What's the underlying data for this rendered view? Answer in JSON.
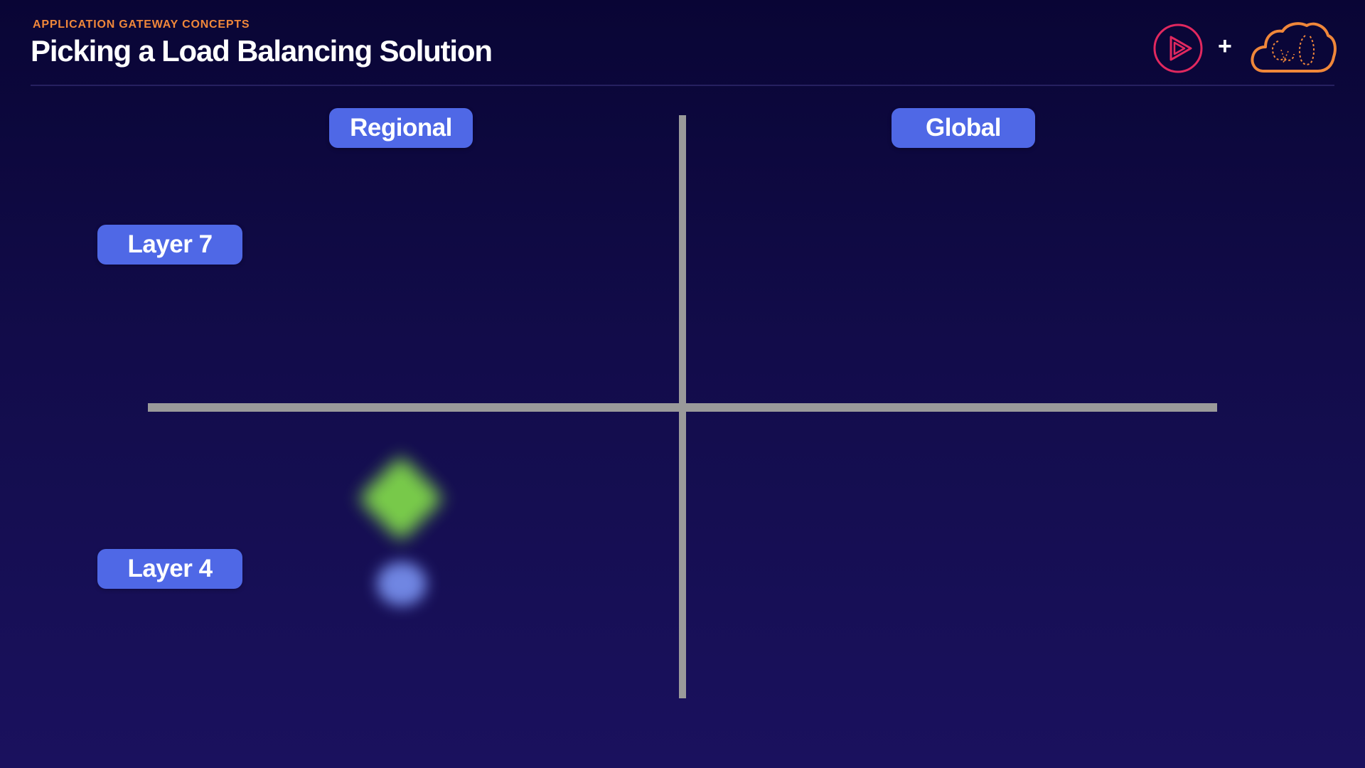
{
  "header": {
    "eyebrow": "APPLICATION GATEWAY CONCEPTS",
    "title": "Picking a Load Balancing Solution",
    "plus": "+"
  },
  "quadrant": {
    "columns": [
      "Regional",
      "Global"
    ],
    "rows": [
      "Layer 7",
      "Layer 4"
    ]
  },
  "markers": [
    {
      "shape": "diamond",
      "color": "#7ed44a",
      "quadrant": "Regional / Layer 4"
    },
    {
      "shape": "circle",
      "color": "#7a93f2",
      "quadrant": "Regional / Layer 4"
    }
  ],
  "colors": {
    "pill": "#4f68e6",
    "accent": "#f0873a",
    "axis": "#9a9a9a",
    "logo_play": "#e1285f",
    "logo_cloud": "#f0873a"
  },
  "icons": [
    "pluralsight-play-icon",
    "cloud-brain-icon"
  ]
}
